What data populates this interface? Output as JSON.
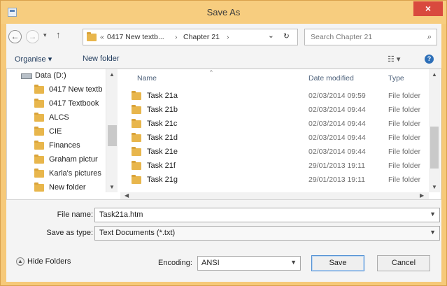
{
  "window": {
    "title": "Save As",
    "close_glyph": "×"
  },
  "nav": {
    "back_glyph": "←",
    "forward_glyph": "→",
    "recent_glyph": "▾",
    "up_glyph": "↑",
    "breadcrumb_overflow": "«",
    "breadcrumb": [
      "0417 New textb...",
      "Chapter 21"
    ],
    "breadcrumb_sep": "›",
    "address_dropdown_glyph": "⌄",
    "refresh_glyph": "↻",
    "search_placeholder": "Search Chapter 21",
    "search_glyph": "⌕"
  },
  "toolbar": {
    "organise": "Organise ▾",
    "new_folder": "New folder",
    "view_glyph": "☷ ▾",
    "help_glyph": "?"
  },
  "tree": {
    "drive_label": "Data (D:)",
    "items": [
      "0417 New textb",
      "0417 Textbook",
      "ALCS",
      "CIE",
      "Finances",
      "Graham pictur",
      "Karla's pictures",
      "New folder"
    ]
  },
  "list": {
    "columns": {
      "name": "Name",
      "date": "Date modified",
      "type": "Type"
    },
    "sort_glyph": "^",
    "rows": [
      {
        "name": "Task 21a",
        "date": "02/03/2014 09:59",
        "type": "File folder"
      },
      {
        "name": "Task 21b",
        "date": "02/03/2014 09:44",
        "type": "File folder"
      },
      {
        "name": "Task 21c",
        "date": "02/03/2014 09:44",
        "type": "File folder"
      },
      {
        "name": "Task 21d",
        "date": "02/03/2014 09:44",
        "type": "File folder"
      },
      {
        "name": "Task 21e",
        "date": "02/03/2014 09:44",
        "type": "File folder"
      },
      {
        "name": "Task 21f",
        "date": "29/01/2013 19:11",
        "type": "File folder"
      },
      {
        "name": "Task 21g",
        "date": "29/01/2013 19:11",
        "type": "File folder"
      }
    ]
  },
  "form": {
    "filename_label": "File name:",
    "filename_value": "Task21a.htm",
    "savetype_label": "Save as type:",
    "savetype_value": "Text Documents (*.txt)"
  },
  "footer": {
    "hide_folders": "Hide Folders",
    "encoding_label": "Encoding:",
    "encoding_value": "ANSI",
    "save": "Save",
    "cancel": "Cancel"
  },
  "colors": {
    "title_bar": "#f7cd7f",
    "close_button": "#d94a3e",
    "folder": "#e8b64c"
  },
  "icons": [
    "app-icon",
    "close-icon",
    "back-icon",
    "forward-icon",
    "up-icon",
    "folder-icon",
    "drive-icon",
    "search-icon",
    "refresh-icon",
    "view-icon",
    "help-icon",
    "chevron-down-icon"
  ]
}
